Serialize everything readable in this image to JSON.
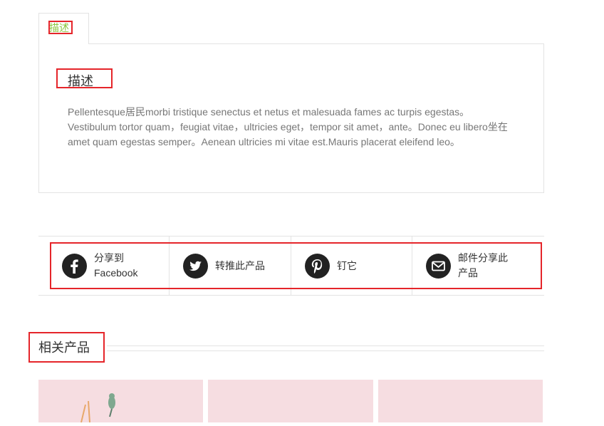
{
  "tabs": [
    {
      "label": "描述"
    }
  ],
  "description": {
    "title": "描述",
    "text_lines": [
      "Pellentesque居民morbi tristique senectus et netus et malesuada fames ac turpis egestas。",
      "Vestibulum tortor quam，feugiat vitae，ultricies eget，tempor sit amet，ante。Donec eu libero坐在",
      "amet quam egestas semper。Aenean ultricies mi vitae est.Mauris placerat eleifend leo。"
    ]
  },
  "share": [
    {
      "icon": "facebook-icon",
      "line1": "分享到",
      "line2": "Facebook"
    },
    {
      "icon": "twitter-icon",
      "line1": "转推此产品",
      "line2": ""
    },
    {
      "icon": "pinterest-icon",
      "line1": "钉它",
      "line2": ""
    },
    {
      "icon": "email-icon",
      "line1": "邮件分享此",
      "line2": "产品"
    }
  ],
  "related": {
    "title": "相关产品"
  },
  "colors": {
    "accent": "#8cc63f",
    "highlight": "#e5252a",
    "icon_bg": "#222222",
    "product_bg": "#f6dde1"
  }
}
